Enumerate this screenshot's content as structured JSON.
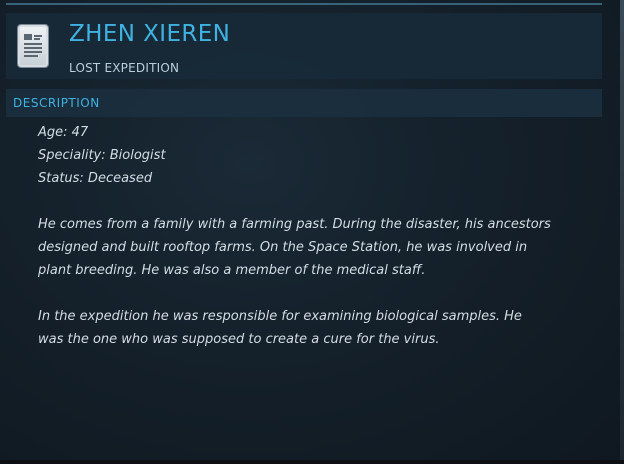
{
  "header": {
    "name": "ZHEN XIEREN",
    "subtitle": "LOST EXPEDITION",
    "icon": "document-icon"
  },
  "section": {
    "label": "DESCRIPTION"
  },
  "stats": [
    "Age: 47",
    "Speciality: Biologist",
    "Status: Deceased"
  ],
  "paragraphs": [
    [
      "He comes from a family with a farming past. During the disaster, his ancestors",
      "designed and built rooftop farms. On the Space Station, he was involved in",
      "plant breeding. He was also a member of the medical staff."
    ],
    [
      "In the expedition he was responsible for examining biological samples. He",
      "was the one who was supposed to create a cure for the virus."
    ]
  ],
  "colors": {
    "accent": "#3fb2e2",
    "text": "#d2dde4",
    "panel": "#182a38"
  }
}
